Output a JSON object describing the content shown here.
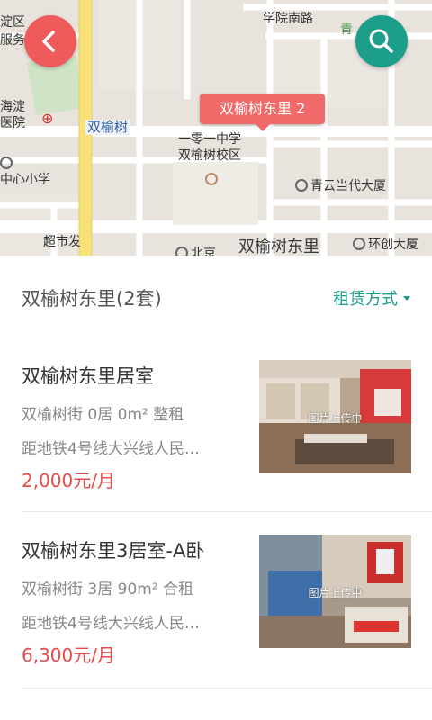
{
  "map": {
    "marker_label": "双榆树东里 2",
    "labels": {
      "xueyuan_south_rd": "学院南路",
      "qing": "青",
      "dian_qu": "淀区",
      "fu_wu": "服务",
      "haidian": "海淀",
      "yiyuan": "医院",
      "shuangyushu_road": "双榆树",
      "school_line1": "一零一中学",
      "school_line2": "双榆树校区",
      "zhongxin_xiaoxue": "中心小学",
      "qingyun": "青云当代大厦",
      "chaoshi": "超市发",
      "beijing": "北京",
      "shuangyushu_dongli": "双榆树东里",
      "huanchuang": "环创大厦"
    }
  },
  "list": {
    "header_title": "双榆树东里(2套)",
    "filter_label": "租赁方式",
    "items": [
      {
        "title": "双榆树东里居室",
        "meta": "双榆树街 0居 0m² 整租",
        "distance": "距地铁4号线大兴线人民…",
        "price": "2,000元/月",
        "image_caption": "图片上传中"
      },
      {
        "title": "双榆树东里3居室-A卧",
        "meta": "双榆树街 3居 90m² 合租",
        "distance": "距地铁4号线大兴线人民…",
        "price": "6,300元/月",
        "image_caption": "图片上传中"
      }
    ]
  },
  "colors": {
    "accent_red": "#ef5b5b",
    "accent_teal": "#1c9e8b",
    "price_red": "#e84b4b"
  },
  "icons": {
    "back": "chevron-left-icon",
    "search": "search-icon",
    "filter": "caret-down-icon"
  }
}
